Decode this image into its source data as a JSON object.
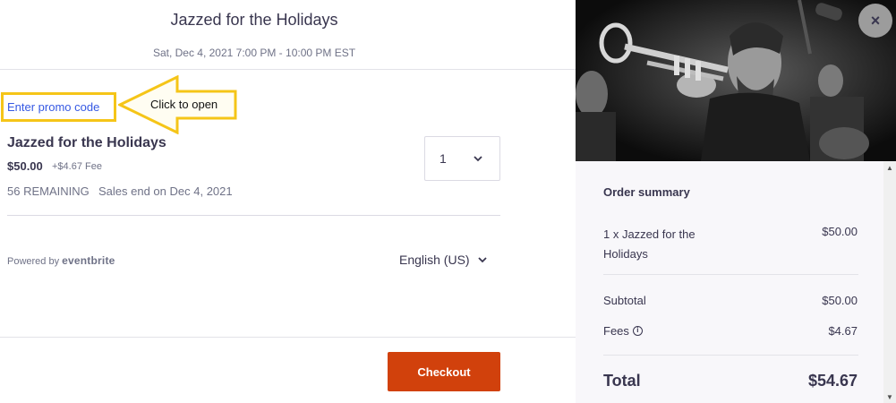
{
  "event": {
    "title": "Jazzed for the Holidays",
    "date": "Sat, Dec 4, 2021 7:00 PM - 10:00 PM EST"
  },
  "promo": {
    "link_label": "Enter promo code",
    "callout_text": "Click to open"
  },
  "ticket": {
    "name": "Jazzed for the Holidays",
    "price": "$50.00",
    "fee": "+$4.67 Fee",
    "remaining": "56 REMAINING",
    "sales_end": "Sales end on Dec 4, 2021",
    "quantity": "1"
  },
  "footer": {
    "powered_prefix": "Powered by",
    "powered_brand": "eventbrite",
    "language": "English (US)",
    "checkout_label": "Checkout"
  },
  "summary": {
    "title": "Order summary",
    "line_item": "1 x Jazzed for the Holidays",
    "line_item_amount": "$50.00",
    "subtotal_label": "Subtotal",
    "subtotal_amount": "$50.00",
    "fees_label": "Fees",
    "fees_amount": "$4.67",
    "total_label": "Total",
    "total_amount": "$54.67"
  },
  "close_label": "×",
  "colors": {
    "accent": "#d1410c",
    "link": "#3659e3",
    "highlight": "#f5c518",
    "text": "#39364f"
  }
}
